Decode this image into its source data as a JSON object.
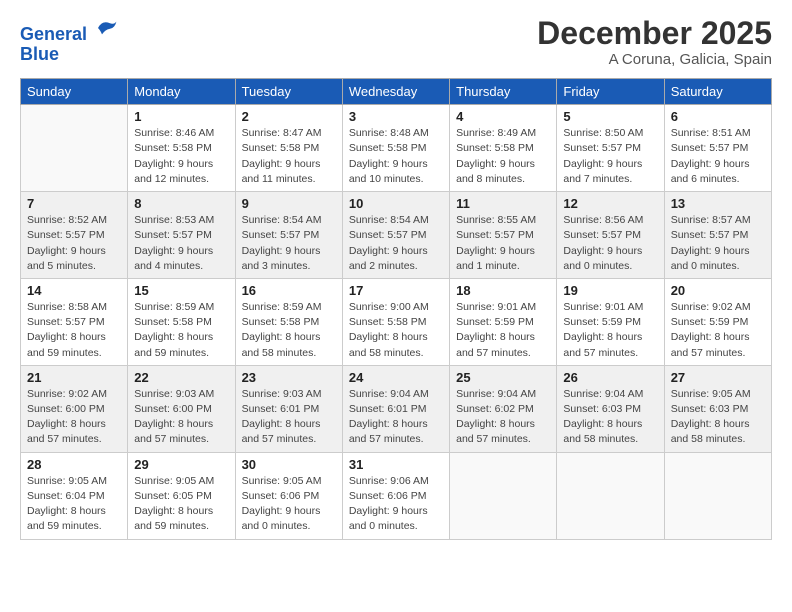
{
  "header": {
    "logo_line1": "General",
    "logo_line2": "Blue",
    "month": "December 2025",
    "location": "A Coruna, Galicia, Spain"
  },
  "weekdays": [
    "Sunday",
    "Monday",
    "Tuesday",
    "Wednesday",
    "Thursday",
    "Friday",
    "Saturday"
  ],
  "weeks": [
    [
      {
        "day": "",
        "info": ""
      },
      {
        "day": "1",
        "info": "Sunrise: 8:46 AM\nSunset: 5:58 PM\nDaylight: 9 hours\nand 12 minutes."
      },
      {
        "day": "2",
        "info": "Sunrise: 8:47 AM\nSunset: 5:58 PM\nDaylight: 9 hours\nand 11 minutes."
      },
      {
        "day": "3",
        "info": "Sunrise: 8:48 AM\nSunset: 5:58 PM\nDaylight: 9 hours\nand 10 minutes."
      },
      {
        "day": "4",
        "info": "Sunrise: 8:49 AM\nSunset: 5:58 PM\nDaylight: 9 hours\nand 8 minutes."
      },
      {
        "day": "5",
        "info": "Sunrise: 8:50 AM\nSunset: 5:57 PM\nDaylight: 9 hours\nand 7 minutes."
      },
      {
        "day": "6",
        "info": "Sunrise: 8:51 AM\nSunset: 5:57 PM\nDaylight: 9 hours\nand 6 minutes."
      }
    ],
    [
      {
        "day": "7",
        "info": "Sunrise: 8:52 AM\nSunset: 5:57 PM\nDaylight: 9 hours\nand 5 minutes."
      },
      {
        "day": "8",
        "info": "Sunrise: 8:53 AM\nSunset: 5:57 PM\nDaylight: 9 hours\nand 4 minutes."
      },
      {
        "day": "9",
        "info": "Sunrise: 8:54 AM\nSunset: 5:57 PM\nDaylight: 9 hours\nand 3 minutes."
      },
      {
        "day": "10",
        "info": "Sunrise: 8:54 AM\nSunset: 5:57 PM\nDaylight: 9 hours\nand 2 minutes."
      },
      {
        "day": "11",
        "info": "Sunrise: 8:55 AM\nSunset: 5:57 PM\nDaylight: 9 hours\nand 1 minute."
      },
      {
        "day": "12",
        "info": "Sunrise: 8:56 AM\nSunset: 5:57 PM\nDaylight: 9 hours\nand 0 minutes."
      },
      {
        "day": "13",
        "info": "Sunrise: 8:57 AM\nSunset: 5:57 PM\nDaylight: 9 hours\nand 0 minutes."
      }
    ],
    [
      {
        "day": "14",
        "info": "Sunrise: 8:58 AM\nSunset: 5:57 PM\nDaylight: 8 hours\nand 59 minutes."
      },
      {
        "day": "15",
        "info": "Sunrise: 8:59 AM\nSunset: 5:58 PM\nDaylight: 8 hours\nand 59 minutes."
      },
      {
        "day": "16",
        "info": "Sunrise: 8:59 AM\nSunset: 5:58 PM\nDaylight: 8 hours\nand 58 minutes."
      },
      {
        "day": "17",
        "info": "Sunrise: 9:00 AM\nSunset: 5:58 PM\nDaylight: 8 hours\nand 58 minutes."
      },
      {
        "day": "18",
        "info": "Sunrise: 9:01 AM\nSunset: 5:59 PM\nDaylight: 8 hours\nand 57 minutes."
      },
      {
        "day": "19",
        "info": "Sunrise: 9:01 AM\nSunset: 5:59 PM\nDaylight: 8 hours\nand 57 minutes."
      },
      {
        "day": "20",
        "info": "Sunrise: 9:02 AM\nSunset: 5:59 PM\nDaylight: 8 hours\nand 57 minutes."
      }
    ],
    [
      {
        "day": "21",
        "info": "Sunrise: 9:02 AM\nSunset: 6:00 PM\nDaylight: 8 hours\nand 57 minutes."
      },
      {
        "day": "22",
        "info": "Sunrise: 9:03 AM\nSunset: 6:00 PM\nDaylight: 8 hours\nand 57 minutes."
      },
      {
        "day": "23",
        "info": "Sunrise: 9:03 AM\nSunset: 6:01 PM\nDaylight: 8 hours\nand 57 minutes."
      },
      {
        "day": "24",
        "info": "Sunrise: 9:04 AM\nSunset: 6:01 PM\nDaylight: 8 hours\nand 57 minutes."
      },
      {
        "day": "25",
        "info": "Sunrise: 9:04 AM\nSunset: 6:02 PM\nDaylight: 8 hours\nand 57 minutes."
      },
      {
        "day": "26",
        "info": "Sunrise: 9:04 AM\nSunset: 6:03 PM\nDaylight: 8 hours\nand 58 minutes."
      },
      {
        "day": "27",
        "info": "Sunrise: 9:05 AM\nSunset: 6:03 PM\nDaylight: 8 hours\nand 58 minutes."
      }
    ],
    [
      {
        "day": "28",
        "info": "Sunrise: 9:05 AM\nSunset: 6:04 PM\nDaylight: 8 hours\nand 59 minutes."
      },
      {
        "day": "29",
        "info": "Sunrise: 9:05 AM\nSunset: 6:05 PM\nDaylight: 8 hours\nand 59 minutes."
      },
      {
        "day": "30",
        "info": "Sunrise: 9:05 AM\nSunset: 6:06 PM\nDaylight: 9 hours\nand 0 minutes."
      },
      {
        "day": "31",
        "info": "Sunrise: 9:06 AM\nSunset: 6:06 PM\nDaylight: 9 hours\nand 0 minutes."
      },
      {
        "day": "",
        "info": ""
      },
      {
        "day": "",
        "info": ""
      },
      {
        "day": "",
        "info": ""
      }
    ]
  ]
}
